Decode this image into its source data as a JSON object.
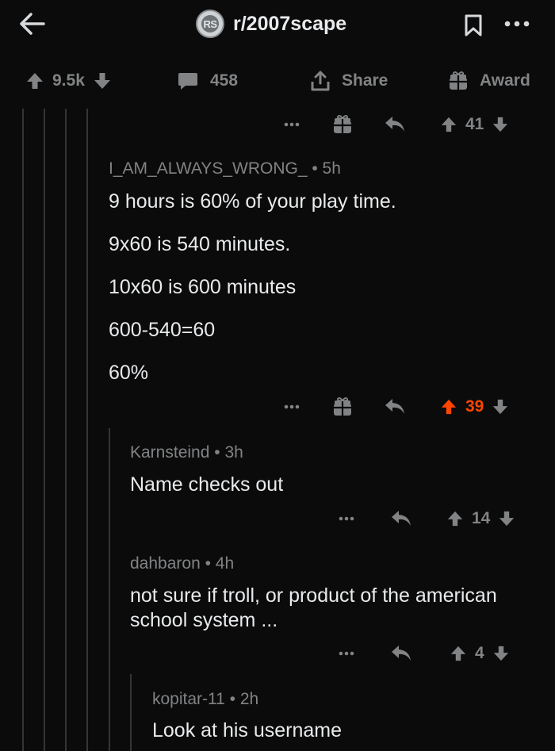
{
  "header": {
    "subreddit": "r/2007scape",
    "avatar_text": "RS"
  },
  "post_bar": {
    "votes": "9.5k",
    "comments": "458",
    "share_label": "Share",
    "award_label": "Award"
  },
  "comments": [
    {
      "score": "41"
    },
    {
      "author": "I_AM_ALWAYS_WRONG_",
      "age": "5h",
      "lines": [
        "9 hours is 60% of your play time.",
        "9x60 is 540 minutes.",
        "10x60 is 600 minutes",
        "600-540=60",
        "60%"
      ],
      "score": "39",
      "upvoted": true
    },
    {
      "author": "Karnsteind",
      "age": "3h",
      "lines": [
        "Name checks out"
      ],
      "score": "14"
    },
    {
      "author": "dahbaron",
      "age": "4h",
      "lines": [
        "not sure if troll, or product of the american",
        "school system ..."
      ],
      "score": "4"
    },
    {
      "author": "kopitar-11",
      "age": "2h",
      "lines": [
        "Look at his username"
      ]
    }
  ],
  "colors": {
    "background": "#0b0b0c",
    "upvote_active": "#ff4500",
    "text_muted": "#818384",
    "text": "#d7dadc"
  },
  "icons": [
    "back-arrow-icon",
    "subreddit-avatar-icon",
    "bookmark-icon",
    "more-icon",
    "upvote-icon",
    "downvote-icon",
    "comment-icon",
    "share-icon",
    "award-icon",
    "reply-icon"
  ]
}
